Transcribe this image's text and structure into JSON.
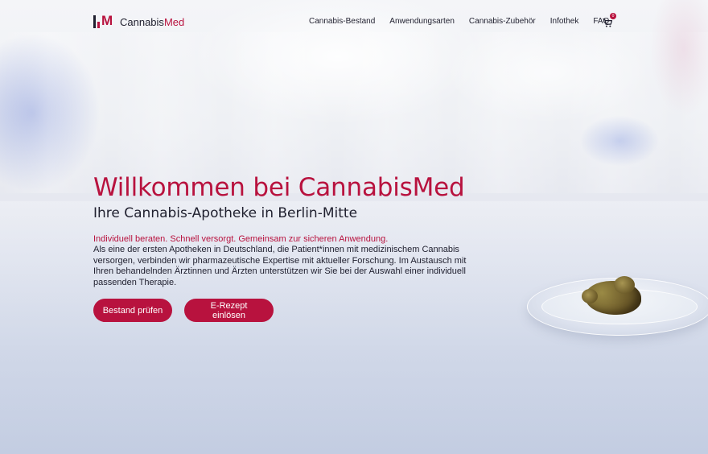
{
  "brand": {
    "name_part1": "Cannabis",
    "name_part2": "Med",
    "accent_color": "#b8123e"
  },
  "nav": {
    "items": [
      {
        "label": "Cannabis-Bestand"
      },
      {
        "label": "Anwendungsarten"
      },
      {
        "label": "Cannabis-Zubehör"
      },
      {
        "label": "Infothek"
      },
      {
        "label": "FAQ"
      }
    ],
    "cart_icon": "cart-icon",
    "cart_count": "0"
  },
  "hero": {
    "title": "Willkommen bei CannabisMed",
    "subtitle": "Ihre Cannabis-Apotheke in Berlin-Mitte",
    "tagline": "Individuell beraten. Schnell versorgt. Gemeinsam zur sicheren Anwendung.",
    "body": "Als eine der ersten Apotheken in Deutschland, die Patient*innen mit medizinischem Cannabis versorgen, verbinden wir pharmazeutische Expertise mit aktueller Forschung. Im Austausch mit Ihren behandelnden Ärztinnen und Ärzten unterstützen wir Sie bei der Auswahl einer individuell passenden Therapie.",
    "primary_button": "Bestand prüfen",
    "secondary_button": "E-Rezept einlösen"
  }
}
